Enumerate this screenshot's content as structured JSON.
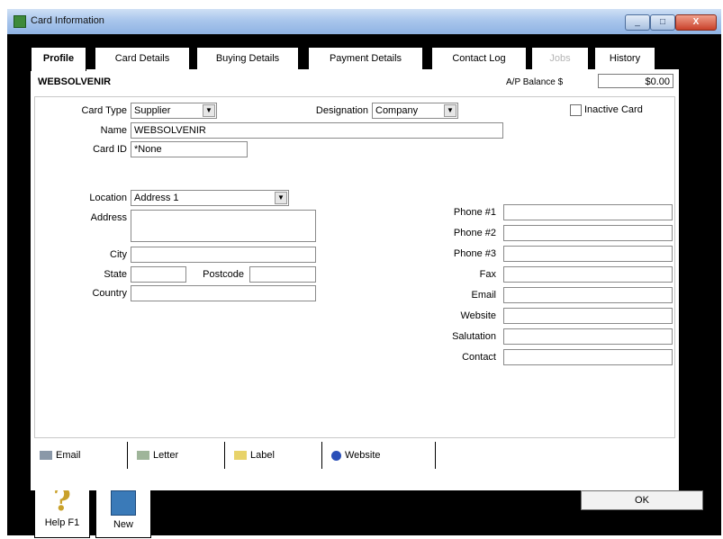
{
  "window": {
    "title": "Card Information",
    "min_label": "_",
    "max_label": "□",
    "close_label": "X"
  },
  "tabs": [
    {
      "label": "Profile"
    },
    {
      "label": "Card Details"
    },
    {
      "label": "Buying Details"
    },
    {
      "label": "Payment Details"
    },
    {
      "label": "Contact Log"
    },
    {
      "label": "Jobs"
    },
    {
      "label": "History"
    }
  ],
  "header": {
    "company_name": "WEBSOLVENIR",
    "balance_label": "A/P Balance $",
    "balance_value": "$0.00"
  },
  "profile": {
    "card_type_label": "Card Type",
    "card_type_value": "Supplier",
    "designation_label": "Designation",
    "designation_value": "Company",
    "inactive_label": "Inactive Card",
    "name_label": "Name",
    "name_value": "WEBSOLVENIR",
    "card_id_label": "Card ID",
    "card_id_value": "*None",
    "location_label": "Location",
    "location_value": "Address 1",
    "address_label": "Address",
    "address_value": "",
    "city_label": "City",
    "city_value": "",
    "state_label": "State",
    "state_value": "",
    "postcode_label": "Postcode",
    "postcode_value": "",
    "country_label": "Country",
    "country_value": "",
    "phone1_label": "Phone #1",
    "phone1_value": "",
    "phone2_label": "Phone #2",
    "phone2_value": "",
    "phone3_label": "Phone #3",
    "phone3_value": "",
    "fax_label": "Fax",
    "fax_value": "",
    "email_label": "Email",
    "email_value": "",
    "website_label": "Website",
    "website_value": "",
    "salutation_label": "Salutation",
    "salutation_value": "",
    "contact_label": "Contact",
    "contact_value": ""
  },
  "bottom_tabs": [
    {
      "label": "Email",
      "icon": "email-icon"
    },
    {
      "label": "Letter",
      "icon": "letter-icon"
    },
    {
      "label": "Label",
      "icon": "label-icon"
    },
    {
      "label": "Website",
      "icon": "globe-icon"
    }
  ],
  "footer": {
    "help_label": "Help F1",
    "new_label": "New",
    "ok_label": "OK"
  }
}
